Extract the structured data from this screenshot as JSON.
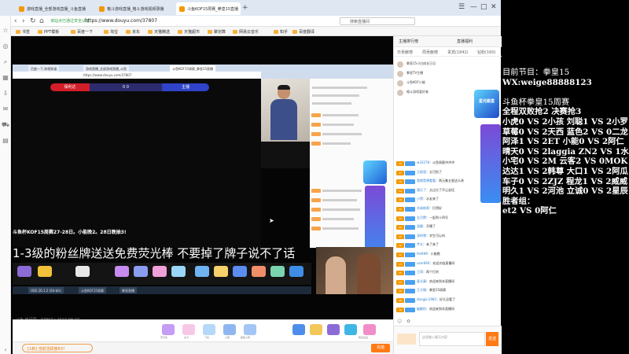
{
  "browser": {
    "tabs": [
      {
        "label": "游戏直播_全部游戏直播_斗鱼直播"
      },
      {
        "label": "格斗游戏直播_格斗游戏视频录播"
      },
      {
        "label": "斗鱼KOF15周赛_拳皇15直播"
      }
    ],
    "url": "https://www.douyu.com/37807",
    "security_label": "该站点已通过安全认证",
    "search_placeholder": "搜索直播间",
    "bookmarks": [
      "书签",
      "PPT模板",
      "百度一下",
      "淘宝",
      "京东",
      "天猫精选",
      "天猫超市",
      "聚划算",
      "网易云音乐",
      "知乎",
      "百度翻译"
    ],
    "icon_add_tab": "+",
    "icon_back": "‹",
    "icon_forward": "›",
    "icon_refresh": "↻",
    "icon_home": "⌂"
  },
  "video": {
    "inner_tabs": [
      "百度一下,你就知道",
      "游戏直播_全部游戏直播_斗鱼",
      "斗鱼KOF15周赛_拳皇15直播"
    ],
    "inner_url": "https://www.douyu.com/37807",
    "hud": {
      "left_name": "保利达",
      "score": "0 0",
      "right_name": "主播"
    },
    "ticker": "斗鱼杯KOF15周赛27-28日。小能晚2。28日晚抽3!",
    "caption": "1-3级的粉丝牌送送免费荧光棒  不要掉了牌子说不了话",
    "room_info": "斗鱼 房间号：37807 | 2022.08.27",
    "taskbar_items": [
      "OBS 26.1.2 (64-bit)",
      "斗鱼KOF15周赛",
      "拳皇直播"
    ]
  },
  "giftbar": {
    "gift_names": [
      "荧光棒",
      "办卡",
      "飞机",
      "火箭",
      "超级火箭",
      "粉丝宝盒"
    ],
    "fans_text": "[1新] 当前活跃度63！"
  },
  "bottombar": {
    "recharge_label": "充值"
  },
  "chat": {
    "tabs": [
      "主播排行榜",
      "直播福利"
    ],
    "subtabs": [
      "日贡献榜",
      "周贡献榜",
      "贵宾(1842)",
      "钻粉(160)"
    ],
    "promo": "星光殿堂",
    "rankings": [
      "拳皇15小白成长日记",
      "拳皇TV主播",
      "斗鱼KOF小能",
      "格斗游戏爱好者"
    ],
    "messages": [
      {
        "lvl": "29",
        "name": "w32278",
        "text": "：斗鱼周赛冲冲冲"
      },
      {
        "lvl": "27",
        "name": "王昭君",
        "text": "：太可怕了"
      },
      {
        "lvl": "19",
        "name": "我就是想看看",
        "text": "：两元集五星这么贵"
      },
      {
        "lvl": "24",
        "name": "我乐了",
        "text": "：太过分了不让说话"
      },
      {
        "lvl": "18",
        "name": "小黑",
        "text": "：水友来了"
      },
      {
        "lvl": "30",
        "name": "木易修养",
        "text": "：打得好"
      },
      {
        "lvl": "22",
        "name": "五月赞",
        "text": "：一起到十四号"
      },
      {
        "lvl": "20",
        "name": "游客",
        "text": "：开播了"
      },
      {
        "lvl": "15",
        "name": "淳的雪",
        "text": "：学生可以吗"
      },
      {
        "lvl": "26",
        "name": "芋头",
        "text": "：来了来了"
      },
      {
        "lvl": "21",
        "name": "fsh999",
        "text": "：小能晚"
      },
      {
        "lvl": "17",
        "name": "user666",
        "text": "：欢迎光临直播间"
      },
      {
        "lvl": "25",
        "name": "王哥",
        "text": "：两个打的"
      },
      {
        "lvl": "23",
        "name": "夏头康",
        "text": "：欢迎来到本直播间"
      },
      {
        "lvl": "19",
        "name": "王大锤",
        "text": "：拳皇15周赛"
      },
      {
        "lvl": "28",
        "name": "dangjin1982",
        "text": "：好久没看了"
      },
      {
        "lvl": "16",
        "name": "破解奶",
        "text": "：欢迎来到本直播间"
      }
    ],
    "input_placeholder": "这里输入聊天内容",
    "send_label": "发送"
  },
  "info": {
    "lines": [
      "目前节目：拳皇15",
      "WX:weige88888123",
      "",
      "斗鱼杯拳皇15周赛",
      "全程双败抢2 决赛抢3",
      "小虎0 VS 2小孩 刘聪1 VS 2小罗",
      "草莓0 VS 2天西 蓝色2 VS 0二龙",
      "阿泽1 VS  2ET   小能0 VS 2阿仁",
      "晴天0 VS 2laggia ZN2  VS 1水鱼",
      "小宅0 VS    2M     云客2 VS 0MOK",
      "达达1 VS 2韩尊 大口1 VS 2阿瓜",
      "车子0 VS 2ZJZ   程龙1 VS 2威威",
      "明久1 VS 2河池  立诚0 VS 2星辰",
      "胜者组：",
      "et2 VS 0阿仁"
    ]
  },
  "colors": {
    "accent": "#ff7a14",
    "hud_red": "#d31d29",
    "hud_blue": "#2f44c8"
  }
}
